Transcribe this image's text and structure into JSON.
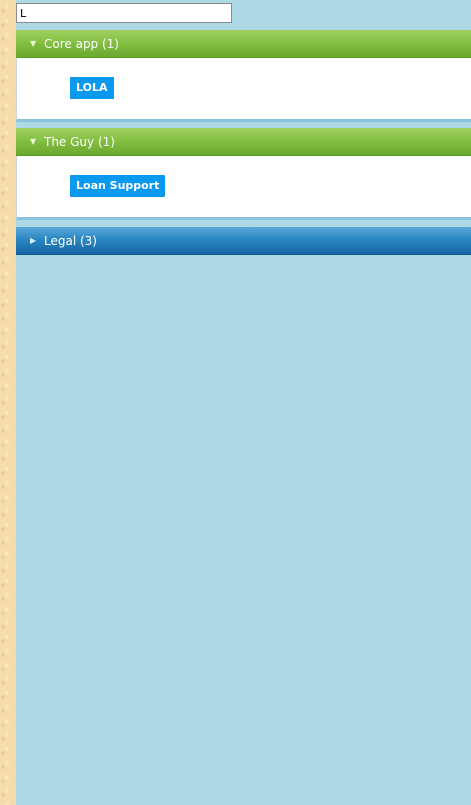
{
  "search": {
    "value": "L"
  },
  "groups": [
    {
      "label": "Core app (1)",
      "expanded_icon": "triangle-down-icon",
      "items": [
        "LOLA"
      ],
      "color": "#84c043"
    },
    {
      "label": "The Guy (1)",
      "expanded_icon": "triangle-down-icon",
      "items": [
        "Loan Support"
      ],
      "color": "#84c043"
    },
    {
      "label": "Legal (3)",
      "expanded_icon": "triangle-right-icon",
      "items": [],
      "color": "#2b87c2"
    }
  ],
  "colors": {
    "panel_background": "#add8e5",
    "page_background": "#f6dcaa",
    "tag_background": "#0b99f0"
  }
}
